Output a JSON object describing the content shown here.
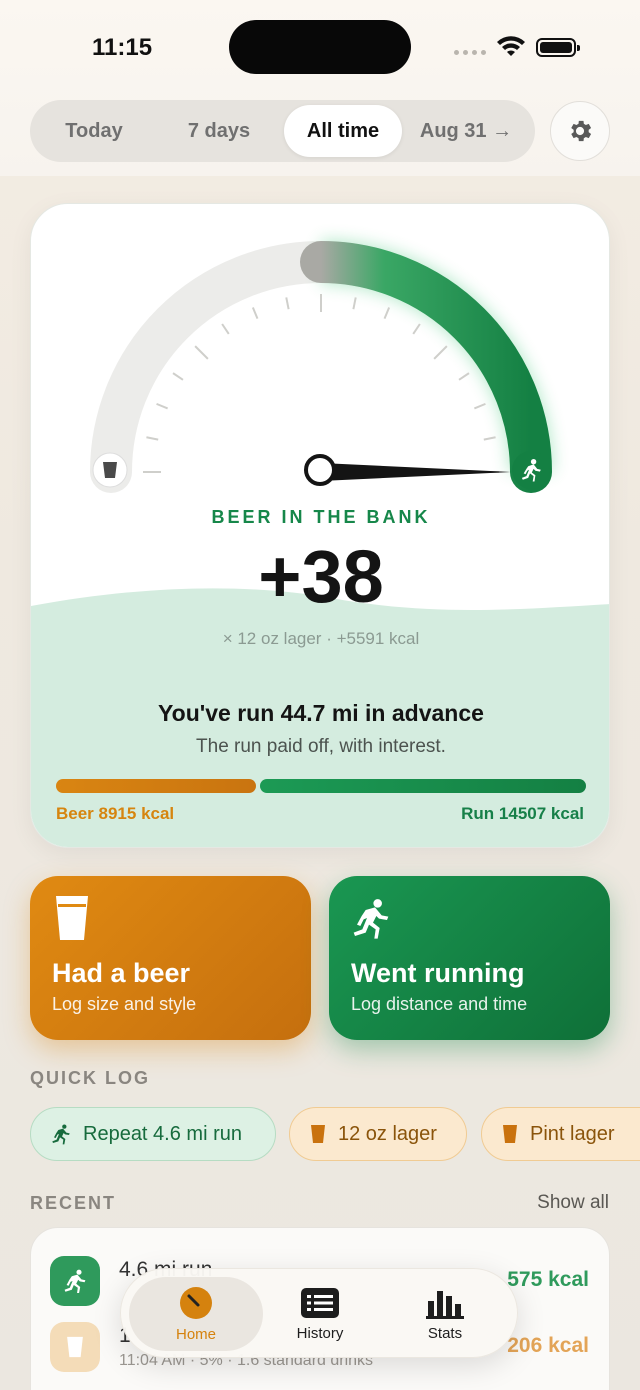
{
  "status_bar": {
    "time": "11:15"
  },
  "segment": {
    "options": [
      "Today",
      "7 days",
      "All time",
      "Aug 31 →"
    ],
    "selected": "All time"
  },
  "bank": {
    "label": "BEER IN THE BANK",
    "value": "+38",
    "sub": "× 12 oz lager · +5591 kcal",
    "advance_title": "You've run 44.7 mi in advance",
    "advance_sub": "The run paid off, with interest.",
    "beer_kcal": "Beer 8915 kcal",
    "run_kcal": "Run 14507 kcal",
    "beer_value": 8915,
    "run_value": 14507
  },
  "actions": {
    "beer": {
      "title": "Had a beer",
      "sub": "Log size and style"
    },
    "run": {
      "title": "Went running",
      "sub": "Log distance and time"
    }
  },
  "quick_log": {
    "label": "QUICK LOG",
    "chips": [
      "Repeat 4.6 mi run",
      "12 oz lager",
      "Pint lager"
    ]
  },
  "recent": {
    "label": "RECENT",
    "show_all": "Show all",
    "items": [
      {
        "title": "4.6 mi run",
        "meta": "",
        "kcal": "575 kcal"
      },
      {
        "title": "1",
        "meta": "11:04 AM · 5% · 1.6 standard drinks",
        "kcal": "206 kcal"
      }
    ]
  },
  "tabbar": {
    "home": "Home",
    "history": "History",
    "stats": "Stats"
  },
  "colors": {
    "beer": "#d98512",
    "run": "#16874a",
    "tab_active": "#d5820e"
  },
  "icons": [
    "gear-icon",
    "beer-glass-icon",
    "runner-icon",
    "gauge-icon",
    "list-icon",
    "bar-chart-icon"
  ]
}
